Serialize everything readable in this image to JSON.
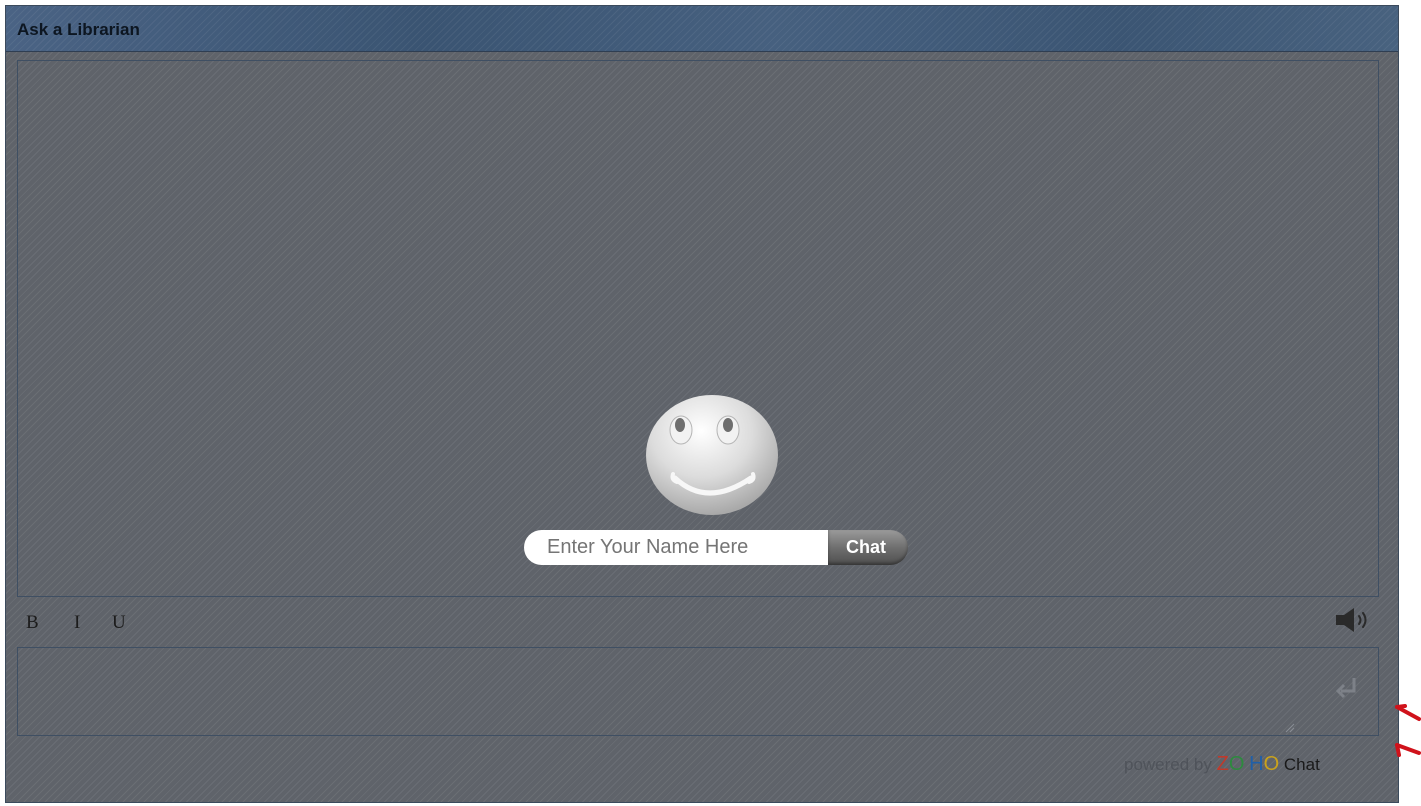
{
  "widget": {
    "title": "Ask a Librarian"
  },
  "start": {
    "name_placeholder": "Enter Your Name Here",
    "chat_button": "Chat"
  },
  "toolbar": {
    "bold": "B",
    "italic": "I",
    "underline": "U",
    "sound_icon": "speaker-icon"
  },
  "composer": {
    "send_icon": "enter-icon"
  },
  "footer": {
    "powered_by": "powered by",
    "brand_z": "Z",
    "brand_o1": "O",
    "brand_h": "H",
    "brand_o2": "O",
    "brand_product": "Chat"
  },
  "colors": {
    "panel_background": "#5f636a",
    "title_bar": "#3d5673",
    "annotation_arrow": "#d0121b"
  }
}
